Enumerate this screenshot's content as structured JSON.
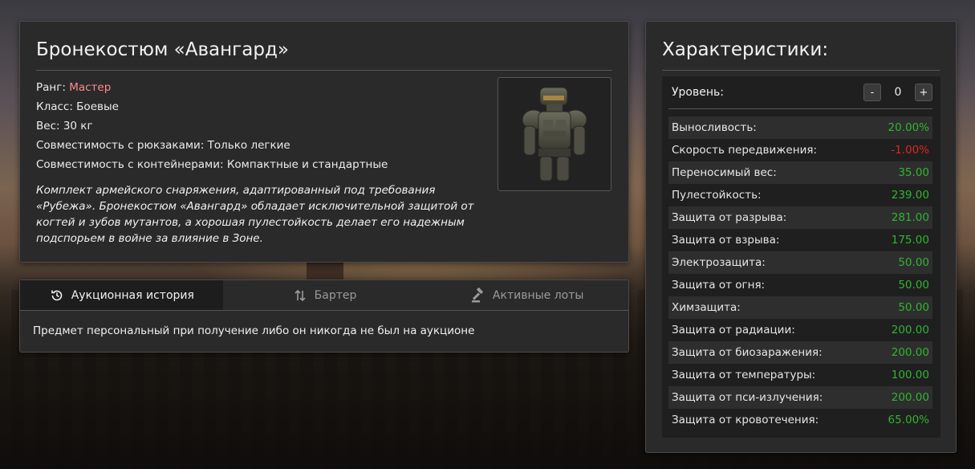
{
  "item": {
    "title": "Бронекостюм «Авангард»",
    "rank_label": "Ранг: ",
    "rank_value": "Мастер",
    "rank_color": "#ff8a8a",
    "class": "Класс: Боевые",
    "weight": "Вес: 30 кг",
    "backpack_compat": "Совместимость с рюкзаками: Только легкие",
    "container_compat": "Совместимость с контейнерами: Компактные и стандартные",
    "description": "Комплект армейского снаряжения, адаптированный под требования «Рубежа». Бронекостюм «Авангард» обладает исключительной защитой от когтей и зубов мутантов, а хорошая пулестойкость делает его надежным подспорьем в войне за влияние в Зоне.",
    "image_icon": "armor-suit-icon"
  },
  "tabs": [
    {
      "label": "Аукционная история",
      "icon": "history-icon",
      "active": true
    },
    {
      "label": "Бартер",
      "icon": "swap-arrows-icon",
      "active": false
    },
    {
      "label": "Активные лоты",
      "icon": "gavel-icon",
      "active": false
    }
  ],
  "tab_content": "Предмет персональный при получение либо он никогда не был на аукционе",
  "stats": {
    "title": "Характеристики:",
    "level_label": "Уровень:",
    "level_minus": "-",
    "level_value": "0",
    "level_plus": "+",
    "positive_color": "#2fb52f",
    "negative_color": "#e02424",
    "rows": [
      {
        "name": "Выносливость:",
        "value": "20.00%"
      },
      {
        "name": "Скорость передвижения:",
        "value": "-1.00%"
      },
      {
        "name": "Переносимый вес:",
        "value": "35.00"
      },
      {
        "name": "Пулестойкость:",
        "value": "239.00"
      },
      {
        "name": "Защита от разрыва:",
        "value": "281.00"
      },
      {
        "name": "Защита от взрыва:",
        "value": "175.00"
      },
      {
        "name": "Электрозащита:",
        "value": "50.00"
      },
      {
        "name": "Защита от огня:",
        "value": "50.00"
      },
      {
        "name": "Химзащита:",
        "value": "50.00"
      },
      {
        "name": "Защита от радиации:",
        "value": "200.00"
      },
      {
        "name": "Защита от биозаражения:",
        "value": "200.00"
      },
      {
        "name": "Защита от температуры:",
        "value": "100.00"
      },
      {
        "name": "Защита от пси-излучения:",
        "value": "200.00"
      },
      {
        "name": "Защита от кровотечения:",
        "value": "65.00%"
      }
    ]
  }
}
